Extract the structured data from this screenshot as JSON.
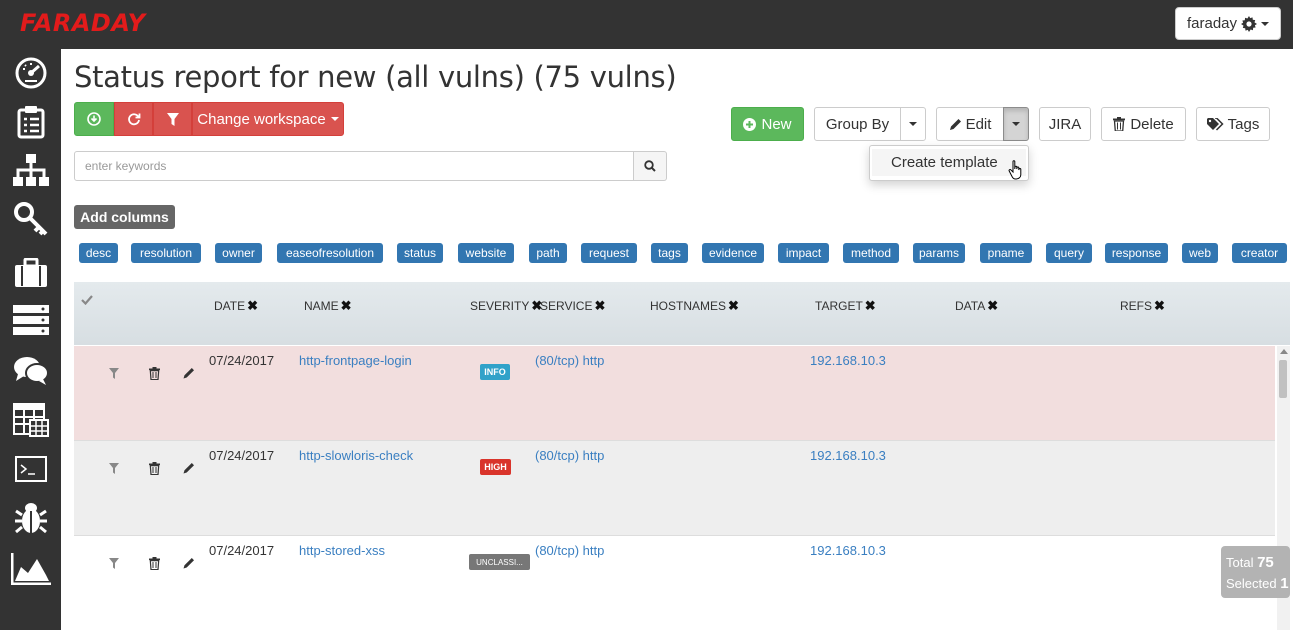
{
  "app": {
    "logo": "FARADAY",
    "user": "faraday"
  },
  "sidebar": {
    "icons": [
      "dashboard-icon",
      "clipboard-icon",
      "hierarchy-icon",
      "key-icon",
      "briefcase-icon",
      "servers-icon",
      "comments-icon",
      "table-icon",
      "terminal-icon",
      "bug-icon",
      "chart-icon"
    ]
  },
  "page": {
    "title": "Status report for new (all vulns) (75 vulns)"
  },
  "toolbar": {
    "change_workspace": "Change workspace",
    "new": "New",
    "group_by": "Group By",
    "edit": "Edit",
    "jira": "JIRA",
    "delete": "Delete",
    "tags": "Tags",
    "dropdown_item": "Create template"
  },
  "search": {
    "placeholder": "enter keywords"
  },
  "add_columns": "Add columns",
  "column_chips": [
    "desc",
    "resolution",
    "owner",
    "easeofresolution",
    "status",
    "website",
    "path",
    "request",
    "tags",
    "evidence",
    "impact",
    "method",
    "params",
    "pname",
    "query",
    "response",
    "web",
    "creator"
  ],
  "table": {
    "headers": [
      "DATE",
      "NAME",
      "SEVERITY",
      "SERVICE",
      "HOSTNAMES",
      "TARGET",
      "DATA",
      "REFS"
    ],
    "rows": [
      {
        "date": "07/24/2017",
        "name": "http-frontpage-login",
        "severity": "INFO",
        "service": "(80/tcp) http",
        "target": "192.168.10.3"
      },
      {
        "date": "07/24/2017",
        "name": "http-slowloris-check",
        "severity": "HIGH",
        "service": "(80/tcp) http",
        "target": "192.168.10.3"
      },
      {
        "date": "07/24/2017",
        "name": "http-stored-xss",
        "severity": "UNCLASSI...",
        "service": "(80/tcp) http",
        "target": "192.168.10.3"
      }
    ]
  },
  "totals": {
    "total_label": "Total",
    "total": "75",
    "selected_label": "Selected",
    "selected": "1"
  },
  "colors": {
    "topbar": "#333333",
    "green": "#5cb85c",
    "red": "#d9534f",
    "chip": "#3276b1",
    "info": "#31a2c9",
    "high": "#d9342b",
    "unclassified": "#777777"
  }
}
